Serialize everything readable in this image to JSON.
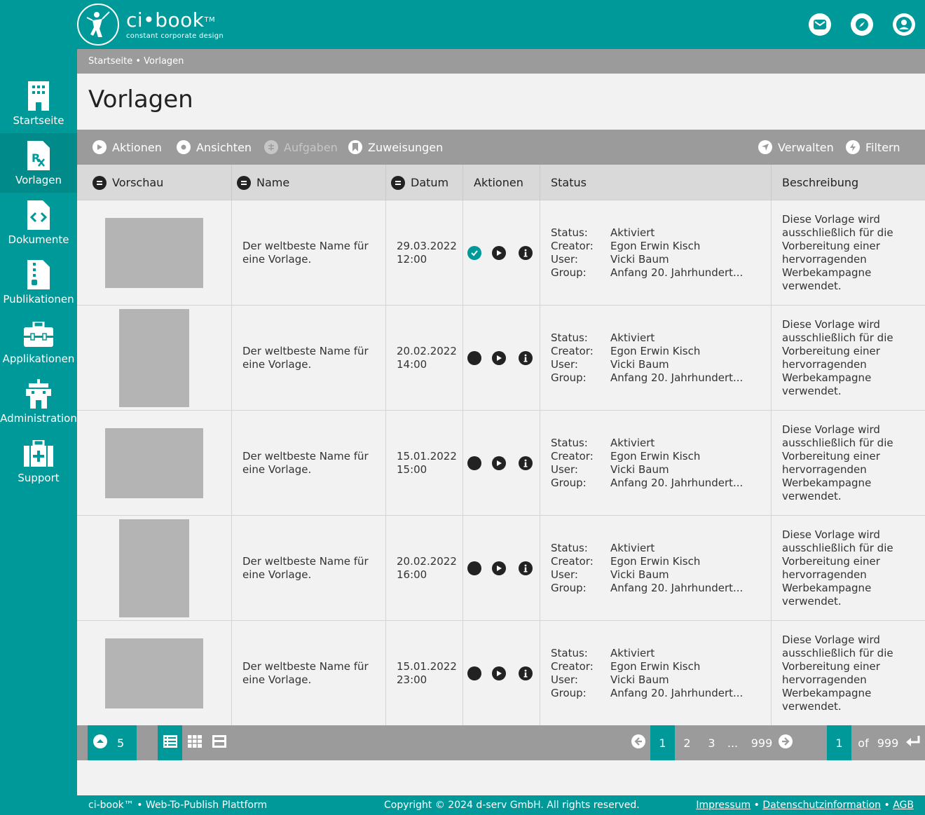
{
  "brand": {
    "name": "ci•book",
    "tm": "TM",
    "tagline": "constant corporate design"
  },
  "header": {
    "icons": [
      "mail-icon",
      "compass-icon",
      "user-icon"
    ]
  },
  "sidebar": {
    "items": [
      {
        "label": "Startseite",
        "icon": "building-icon",
        "active": false
      },
      {
        "label": "Vorlagen",
        "icon": "prescription-file-icon",
        "active": true
      },
      {
        "label": "Dokumente",
        "icon": "code-file-icon",
        "active": false
      },
      {
        "label": "Publikationen",
        "icon": "zip-file-icon",
        "active": false
      },
      {
        "label": "Applikationen",
        "icon": "toolbox-icon",
        "active": false
      },
      {
        "label": "Administration",
        "icon": "tower-icon",
        "active": false
      },
      {
        "label": "Support",
        "icon": "first-aid-icon",
        "active": false
      }
    ]
  },
  "breadcrumb": {
    "text": "Startseite • Vorlagen"
  },
  "page": {
    "title": "Vorlagen"
  },
  "toolbar": {
    "aktionen": "Aktionen",
    "ansichten": "Ansichten",
    "aufgaben": "Aufgaben",
    "zuweisungen": "Zuweisungen",
    "verwalten": "Verwalten",
    "filtern": "Filtern"
  },
  "table": {
    "headers": {
      "vorschau": "Vorschau",
      "name": "Name",
      "datum": "Datum",
      "aktionen": "Aktionen",
      "status": "Status",
      "beschreibung": "Beschreibung"
    },
    "status_labels": {
      "status": "Status:",
      "creator": "Creator:",
      "user": "User:",
      "group": "Group:"
    },
    "rows": [
      {
        "orientation": "landscape",
        "name_line1": "Der weltbeste Name für",
        "name_line2": "eine Vorlage.",
        "date": "29.03.2022",
        "time": "12:00",
        "checked": true,
        "status": "Aktiviert",
        "creator": "Egon Erwin Kisch",
        "user": "Vicki Baum",
        "group": "Anfang 20. Jahrhundert...",
        "desc1": "Diese Vorlage wird",
        "desc2": "ausschließlich für die",
        "desc3": "Vorbereitung einer",
        "desc4": "hervorragenden",
        "desc5": "Werbekampagne",
        "desc6": "verwendet."
      },
      {
        "orientation": "portrait",
        "name_line1": "Der weltbeste Name für",
        "name_line2": "eine Vorlage.",
        "date": "20.02.2022",
        "time": "14:00",
        "checked": false,
        "status": "Aktiviert",
        "creator": "Egon Erwin Kisch",
        "user": "Vicki Baum",
        "group": "Anfang 20. Jahrhundert...",
        "desc1": "Diese Vorlage wird",
        "desc2": "ausschließlich für die",
        "desc3": "Vorbereitung einer",
        "desc4": "hervorragenden",
        "desc5": "Werbekampagne",
        "desc6": "verwendet."
      },
      {
        "orientation": "landscape",
        "name_line1": "Der weltbeste Name für",
        "name_line2": "eine Vorlage.",
        "date": "15.01.2022",
        "time": "15:00",
        "checked": false,
        "status": "Aktiviert",
        "creator": "Egon Erwin Kisch",
        "user": "Vicki Baum",
        "group": "Anfang 20. Jahrhundert...",
        "desc1": "Diese Vorlage wird",
        "desc2": "ausschließlich für die",
        "desc3": "Vorbereitung einer",
        "desc4": "hervorragenden",
        "desc5": "Werbekampagne",
        "desc6": "verwendet."
      },
      {
        "orientation": "portrait",
        "name_line1": "Der weltbeste Name für",
        "name_line2": "eine Vorlage.",
        "date": "20.02.2022",
        "time": "16:00",
        "checked": false,
        "status": "Aktiviert",
        "creator": "Egon Erwin Kisch",
        "user": "Vicki Baum",
        "group": "Anfang 20. Jahrhundert...",
        "desc1": "Diese Vorlage wird",
        "desc2": "ausschließlich für die",
        "desc3": "Vorbereitung einer",
        "desc4": "hervorragenden",
        "desc5": "Werbekampagne",
        "desc6": "verwendet."
      },
      {
        "orientation": "landscape",
        "name_line1": "Der weltbeste Name für",
        "name_line2": "eine Vorlage.",
        "date": "15.01.2022",
        "time": "23:00",
        "checked": false,
        "status": "Aktiviert",
        "creator": "Egon Erwin Kisch",
        "user": "Vicki Baum",
        "group": "Anfang 20. Jahrhundert...",
        "desc1": "Diese Vorlage wird",
        "desc2": "ausschließlich für die",
        "desc3": "Vorbereitung einer",
        "desc4": "hervorragenden",
        "desc5": "Werbekampagne",
        "desc6": "verwendet."
      }
    ]
  },
  "pagination": {
    "per_page": "5",
    "pages": [
      "1",
      "2",
      "3",
      "...",
      "999"
    ],
    "current": "1",
    "goto_value": "1",
    "of_label": "of",
    "total": "999"
  },
  "footer": {
    "left": "ci-book™ • Web-To-Publish Plattform",
    "copyright": "Copyright © 2024 d-serv GmbH. All rights reserved.",
    "impressum": "Impressum",
    "sep": "•",
    "datenschutz": "Datenschutzinformation",
    "agb": "AGB"
  },
  "colors": {
    "teal": "#009999",
    "teal_dark": "#008a8a",
    "grey_bar": "#9b9b9b",
    "header_row": "#d9d9d9",
    "thumb": "#b4b4b4"
  }
}
